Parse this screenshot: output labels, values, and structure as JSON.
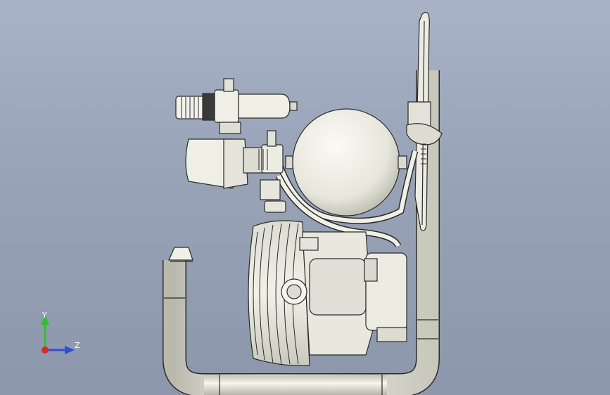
{
  "viewport": {
    "background_top": "#a9b3c7",
    "background_bottom": "#8d97ab",
    "model_fill": "#e9e9e1",
    "model_stroke": "#2a2a2a"
  },
  "triad": {
    "y_label": "Y",
    "z_label": "Z",
    "y_color": "#2fbf2f",
    "z_color": "#2a4fd8",
    "x_color": "#d82a2a"
  }
}
